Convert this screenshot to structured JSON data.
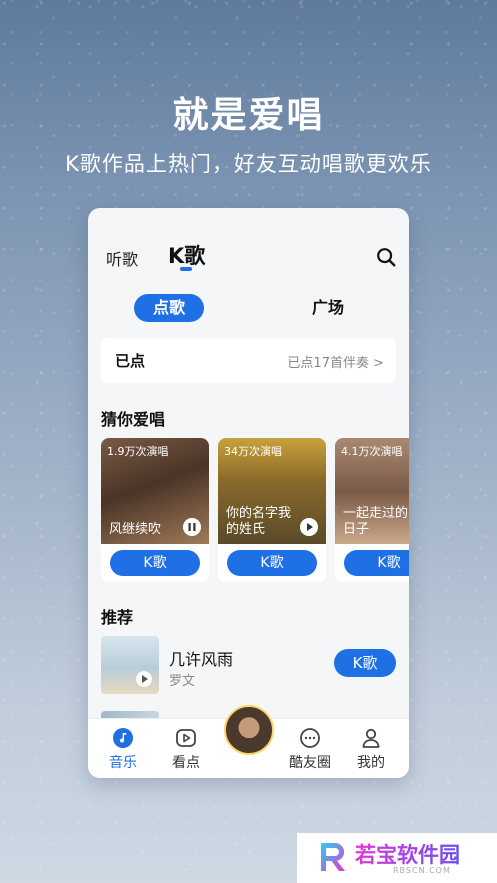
{
  "promo": {
    "headline": "就是爱唱",
    "subline": "K歌作品上热门，好友互动唱歌更欢乐"
  },
  "header": {
    "tab_listen": "听歌",
    "tab_k": "K歌",
    "search_icon": "search-icon"
  },
  "segment": {
    "active": "点歌",
    "other": "广场"
  },
  "queued": {
    "label": "已点",
    "right": "已点17首伴奏 >"
  },
  "guess": {
    "title": "猜你爱唱",
    "cards": [
      {
        "count": "1.9万次演唱",
        "title": "风继续吹",
        "button": "K歌",
        "state": "pause"
      },
      {
        "count": "34万次演唱",
        "title": "你的名字我的姓氏",
        "button": "K歌",
        "state": "play"
      },
      {
        "count": "4.1万次演唱",
        "title": "一起走过的日子",
        "button": "K歌",
        "state": "play"
      }
    ]
  },
  "recommend": {
    "title": "推荐",
    "song": {
      "title": "几许风雨",
      "artist": "罗文",
      "button": "K歌"
    }
  },
  "nav": {
    "items": [
      {
        "label": "音乐",
        "icon": "music-note-icon",
        "active": true
      },
      {
        "label": "看点",
        "icon": "play-square-icon",
        "active": false
      },
      {
        "label": "酷友圈",
        "icon": "chat-bubble-icon",
        "active": false
      },
      {
        "label": "我的",
        "icon": "person-icon",
        "active": false
      }
    ]
  },
  "watermark": {
    "text": "若宝软件园",
    "sub": "RBSCN.COM"
  },
  "colors": {
    "accent": "#1f6fe5",
    "brand_watermark": "#c63ee0"
  }
}
